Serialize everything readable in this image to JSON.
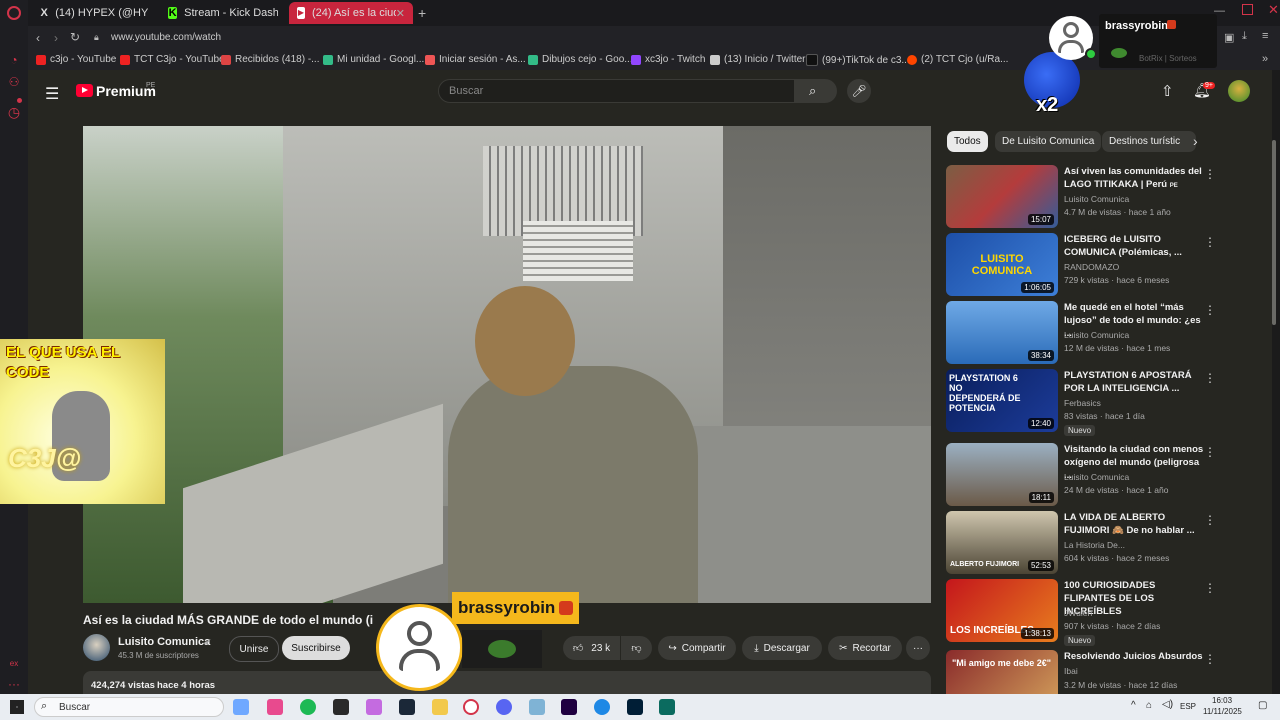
{
  "browser": {
    "tabs": [
      {
        "label": "(14) HYPEX (@HYPEX) / X"
      },
      {
        "label": "Stream - Kick Dashboard"
      },
      {
        "label": "(24) Así es la ciudad MÁS"
      }
    ],
    "address": "www.youtube.com/watch",
    "bookmarks": [
      "c3jo - YouTube",
      "TCT C3jo - YouTube",
      "Recibidos (418) -...",
      "Mi unidad - Googl...",
      "Iniciar sesión - As...",
      "Dibujos cejo - Goo...",
      "xc3jo - Twitch",
      "(13) Inicio / Twitter",
      "(99+)TikTok de c3...",
      "(2) TCT Cjo (u/Ra..."
    ]
  },
  "youtube": {
    "logo_text": "Premium",
    "logo_region": "PE",
    "search_placeholder": "Buscar",
    "notif_count": "9+",
    "video": {
      "title": "Así es la ciudad MÁS GRANDE de todo el mundo (i",
      "channel": "Luisito Comunica",
      "subs": "45.3 M de suscriptores",
      "join": "Unirse",
      "subscribe": "Suscribirse",
      "likes": "23 k",
      "share": "Compartir",
      "download": "Descargar",
      "clip": "Recortar",
      "views": "424,274 vistas",
      "age": "hace 4 horas"
    },
    "chips": [
      "Todos",
      "De Luisito Comunica",
      "Destinos turístic"
    ],
    "related": [
      {
        "title": "Así viven las comunidades del LAGO TITIKAKA | Perú",
        "title_sup": "PE",
        "channel": "Luisito Comunica",
        "meta": "4.7 M de vistas · hace 1 año",
        "duration": "15:07"
      },
      {
        "title": "ICEBERG de LUISITO COMUNICA (Polémicas, ...",
        "channel": "RANDOMAZO",
        "meta": "729 k vistas · hace 6 meses",
        "duration": "1:06:05",
        "thumb_text": "LUISITO COMUNICA"
      },
      {
        "title": "Me quedé en el hotel “más lujoso” de todo el mundo: ¿es ...",
        "channel": "Luisito Comunica",
        "meta": "12 M de vistas · hace 1 mes",
        "duration": "38:34"
      },
      {
        "title": "PLAYSTATION 6 APOSTARÁ POR LA INTELIGENCIA ...",
        "channel": "Ferbasics",
        "meta": "83 vistas · hace 1 día",
        "badge": "Nuevo",
        "duration": "12:40",
        "thumb_text": "PLAYSTATION 6 NO DEPENDERÁ DE POTENCIA"
      },
      {
        "title": "Visitando la ciudad con menos oxígeno del mundo (peligrosa ...",
        "channel": "Luisito Comunica",
        "meta": "24 M de vistas · hace 1 año",
        "duration": "18:11"
      },
      {
        "title": "LA VIDA DE ALBERTO FUJIMORI 🙈 De no hablar ...",
        "channel": "La Historia De...",
        "meta": "604 k vistas · hace 2 meses",
        "duration": "52:53",
        "thumb_text": "ALBERTO FUJIMORI"
      },
      {
        "title": "100 CURIOSIDADES FLIPANTES DE LOS INCREÍBLES",
        "channel": "JWulen",
        "meta": "907 k vistas · hace 2 días",
        "badge": "Nuevo",
        "duration": "1:38:13",
        "thumb_text": "LOS INCREÍBLES"
      },
      {
        "title": "Resolviendo Juicios Absurdos",
        "channel": "Ibai",
        "meta": "3.2 M de vistas · hace 12 días",
        "thumb_text": "\"Mi amigo me debe 2€\""
      }
    ]
  },
  "overlays": {
    "username": "brassyrobin",
    "corner_username": "brassyrobin",
    "corner_sub": "BotRix | Sorteos",
    "multiplier": "x2",
    "code_banner": "EL QUE USA EL CODE",
    "code_text": "C3J@"
  },
  "taskbar": {
    "search": "Buscar",
    "lang": "ESP",
    "time": "16:03",
    "date": "11/11/2025"
  },
  "colors": {
    "accent": "#ff0033",
    "opera": "#d3344a",
    "active_tab": "#c8253d",
    "overlay_yellow": "#f5b81c"
  }
}
